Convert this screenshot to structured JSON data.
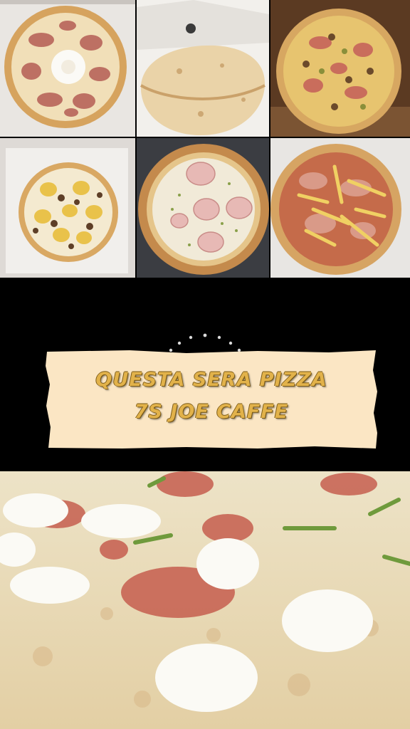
{
  "banner": {
    "line1": "QUESTA SERA PIZZA",
    "line2": "7S JOE CAFFE"
  },
  "colors": {
    "background": "#000000",
    "note_paper": "#fbe6c4",
    "title_text": "#e2b24a",
    "title_outline": "#7a5a18"
  },
  "photos": [
    "pizza-prosciutto-egg-box",
    "calzone-box",
    "pizza-capricciosa",
    "pizza-potato-sausage-box",
    "pizza-white-mortadella",
    "pizza-ham-fries",
    "pizza-white-burrata-closeup"
  ]
}
